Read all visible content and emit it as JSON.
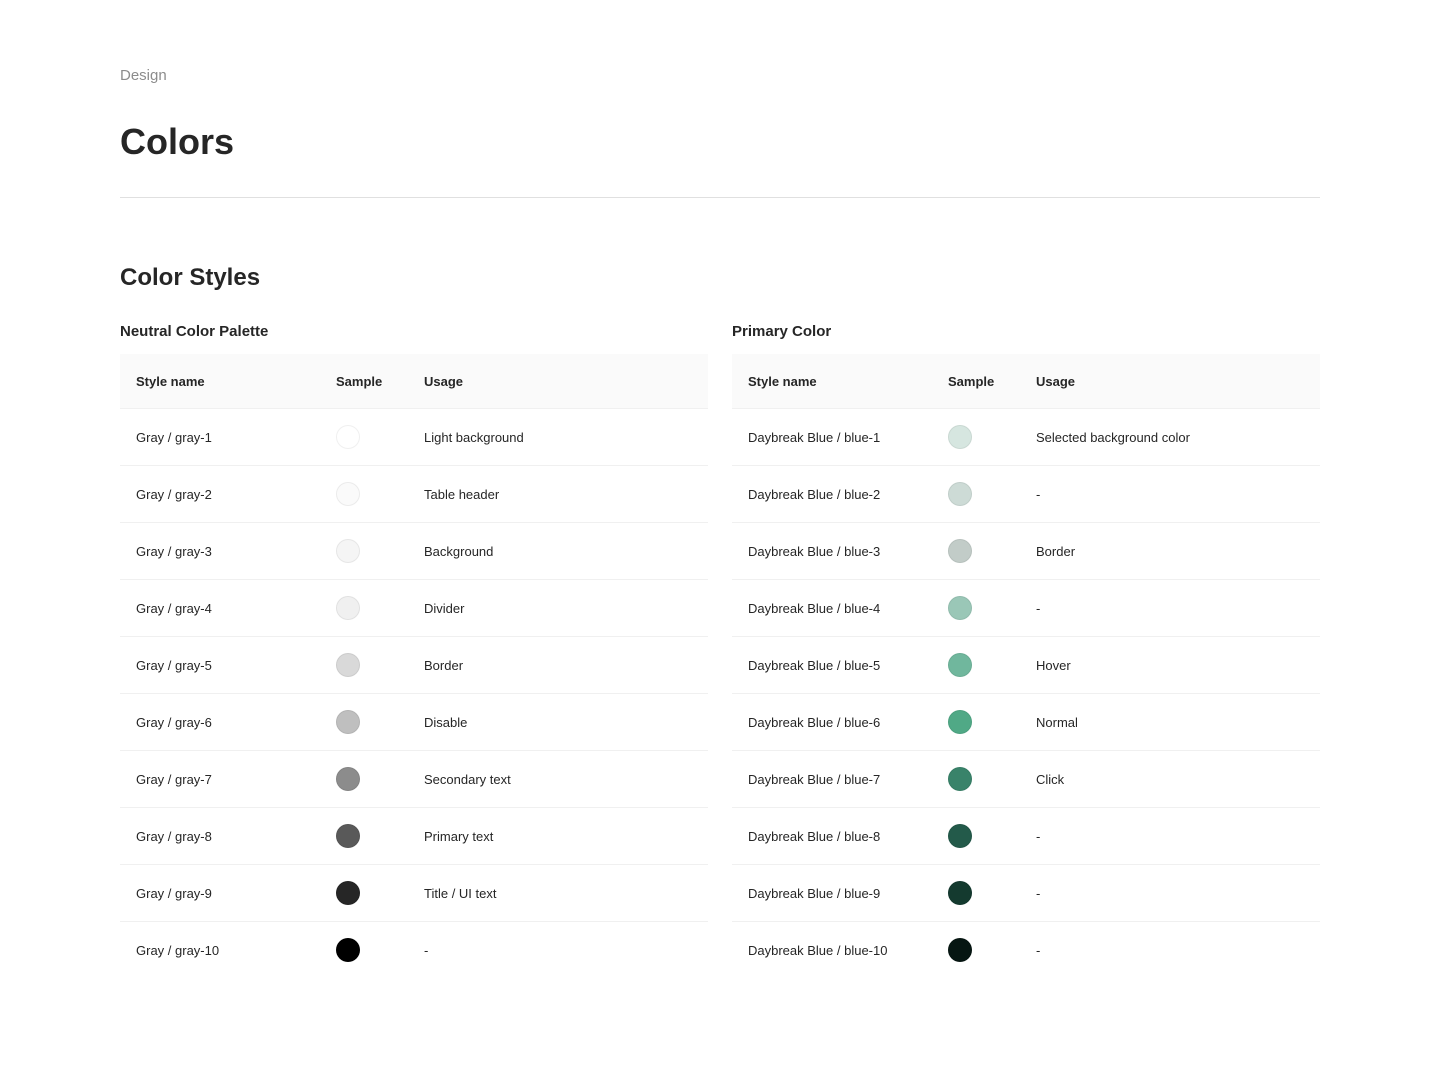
{
  "breadcrumb": "Design",
  "page_title": "Colors",
  "section_title": "Color Styles",
  "palettes": [
    {
      "title": "Neutral Color Palette",
      "headers": {
        "name": "Style name",
        "sample": "Sample",
        "usage": "Usage"
      },
      "rows": [
        {
          "name": "Gray / gray-1",
          "color": "#ffffff",
          "usage": "Light background"
        },
        {
          "name": "Gray / gray-2",
          "color": "#fafafa",
          "usage": "Table header"
        },
        {
          "name": "Gray / gray-3",
          "color": "#f5f5f5",
          "usage": "Background"
        },
        {
          "name": "Gray / gray-4",
          "color": "#f0f0f0",
          "usage": "Divider"
        },
        {
          "name": "Gray / gray-5",
          "color": "#d9d9d9",
          "usage": "Border"
        },
        {
          "name": "Gray / gray-6",
          "color": "#bfbfbf",
          "usage": "Disable"
        },
        {
          "name": "Gray / gray-7",
          "color": "#8c8c8c",
          "usage": "Secondary text"
        },
        {
          "name": "Gray / gray-8",
          "color": "#595959",
          "usage": "Primary text"
        },
        {
          "name": "Gray / gray-9",
          "color": "#262626",
          "usage": "Title / UI text"
        },
        {
          "name": "Gray / gray-10",
          "color": "#000000",
          "usage": "-"
        }
      ]
    },
    {
      "title": "Primary Color",
      "headers": {
        "name": "Style name",
        "sample": "Sample",
        "usage": "Usage"
      },
      "rows": [
        {
          "name": "Daybreak Blue / blue-1",
          "color": "#d6e6e0",
          "usage": "Selected background color"
        },
        {
          "name": "Daybreak Blue / blue-2",
          "color": "#cddbd6",
          "usage": "-"
        },
        {
          "name": "Daybreak Blue / blue-3",
          "color": "#c2ccc8",
          "usage": "Border"
        },
        {
          "name": "Daybreak Blue / blue-4",
          "color": "#9ac7b7",
          "usage": "-"
        },
        {
          "name": "Daybreak Blue / blue-5",
          "color": "#70b79d",
          "usage": "Hover"
        },
        {
          "name": "Daybreak Blue / blue-6",
          "color": "#50a986",
          "usage": "Normal"
        },
        {
          "name": "Daybreak Blue / blue-7",
          "color": "#39836a",
          "usage": "Click"
        },
        {
          "name": "Daybreak Blue / blue-8",
          "color": "#235a4a",
          "usage": "-"
        },
        {
          "name": "Daybreak Blue / blue-9",
          "color": "#143a2f",
          "usage": "-"
        },
        {
          "name": "Daybreak Blue / blue-10",
          "color": "#061612",
          "usage": "-"
        }
      ]
    }
  ]
}
